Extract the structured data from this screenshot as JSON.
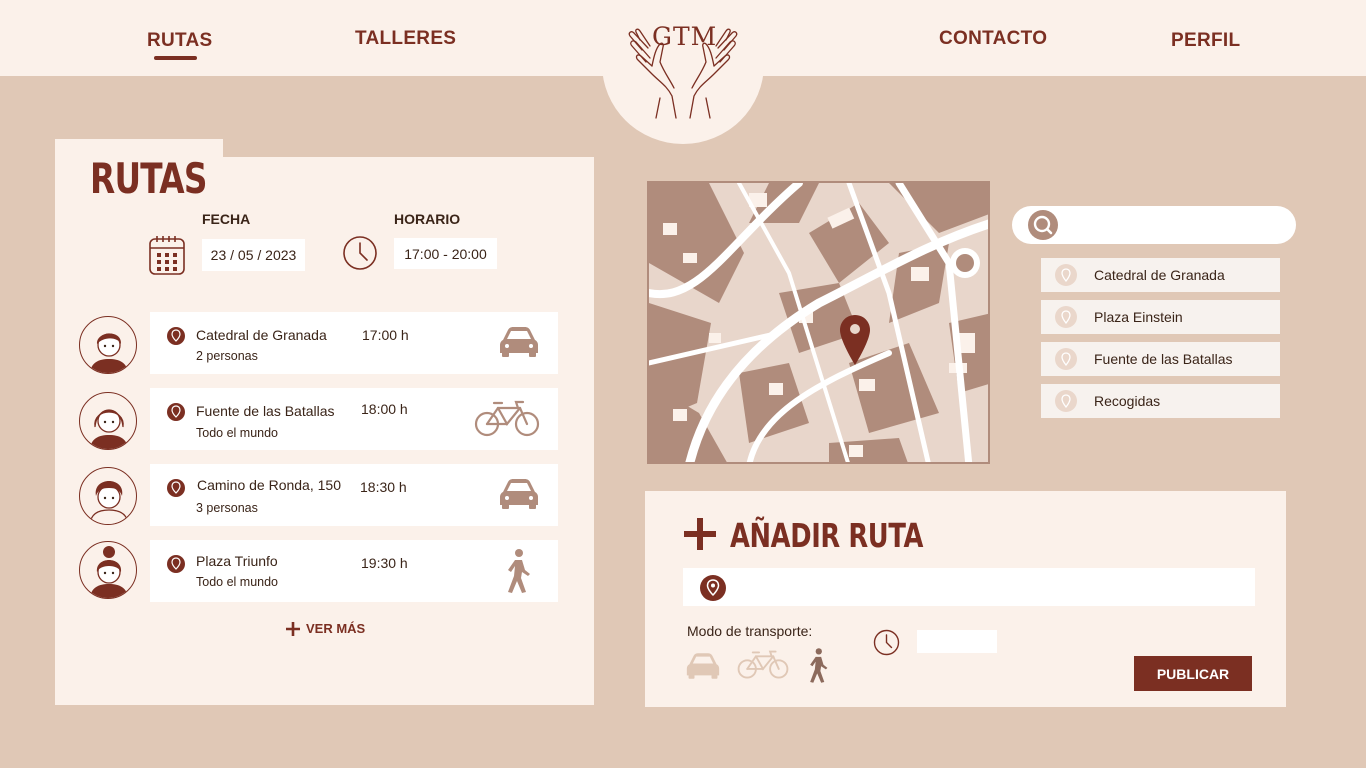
{
  "header": {
    "logo_text": "GTM",
    "nav": [
      {
        "label": "RUTAS",
        "active": true
      },
      {
        "label": "TALLERES",
        "active": false
      },
      {
        "label": "CONTACTO",
        "active": false
      },
      {
        "label": "PERFIL",
        "active": false
      }
    ]
  },
  "rutas_panel": {
    "title": "RUTAS",
    "fecha_label": "FECHA",
    "fecha_value": "23 / 05 / 2023",
    "horario_label": "HORARIO",
    "horario_value": "17:00 - 20:00",
    "routes": [
      {
        "place": "Catedral de Granada",
        "time": "17:00 h",
        "people": "2 personas",
        "mode": "car-icon"
      },
      {
        "place": "Fuente de las Batallas",
        "time": "18:00 h",
        "people": "Todo el mundo",
        "mode": "bicycle-icon"
      },
      {
        "place": "Camino de Ronda, 150",
        "time": "18:30 h",
        "people": "3 personas",
        "mode": "car-icon"
      },
      {
        "place": "Plaza Triunfo",
        "time": "19:30 h",
        "people": "Todo el mundo",
        "mode": "walking-icon"
      }
    ],
    "ver_mas": "VER MÁS"
  },
  "search": {
    "placeholder": "",
    "results": [
      "Catedral de Granada",
      "Plaza Einstein",
      "Fuente de las Batallas",
      "Recogidas"
    ]
  },
  "add_route": {
    "title": "AÑADIR RUTA",
    "location_placeholder": "",
    "modo_label": "Modo de transporte:",
    "modes": [
      "car-icon",
      "bicycle-icon",
      "walking-icon"
    ],
    "selected_mode": "walking-icon",
    "time_placeholder": "",
    "publish_label": "PUBLICAR"
  },
  "colors": {
    "brand": "#7b2f22",
    "background": "#e0c8b6",
    "panel": "#fbf1ea",
    "muted": "#b08c7c"
  }
}
